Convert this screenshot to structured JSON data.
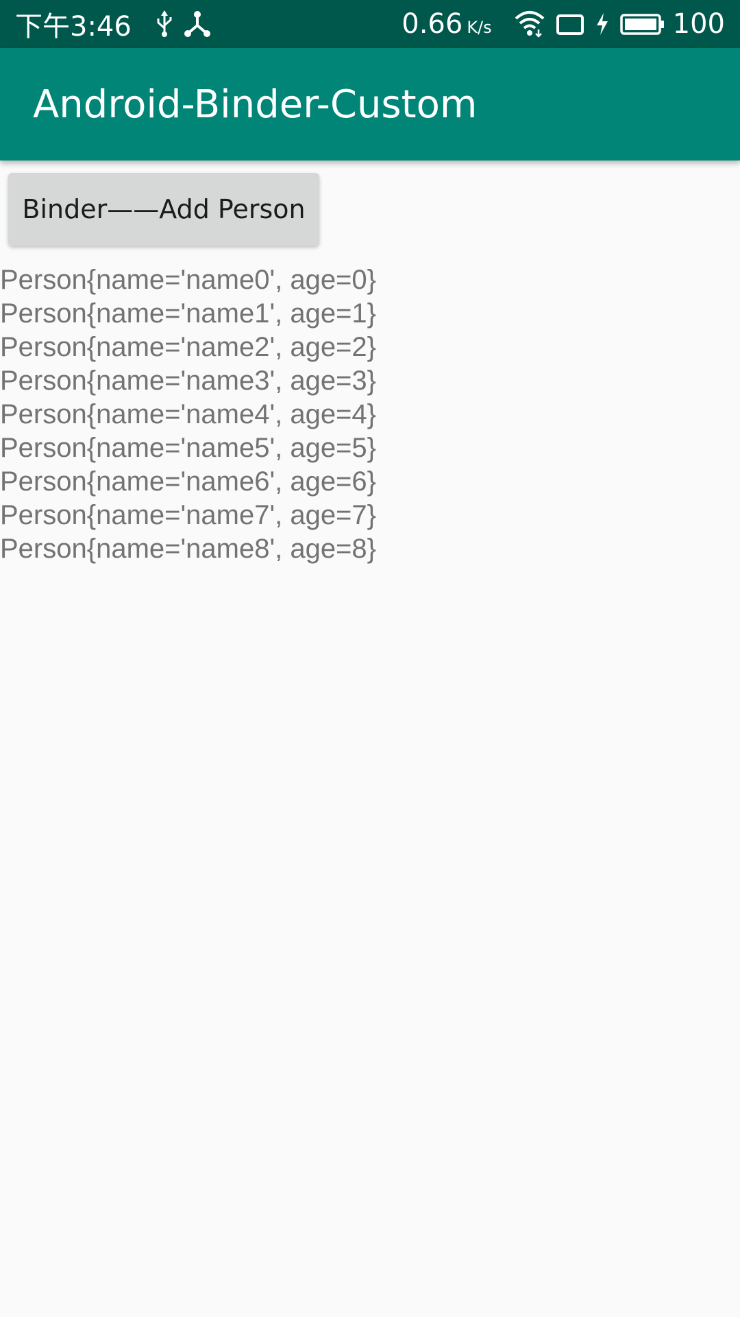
{
  "status_bar": {
    "time": "下午3:46",
    "network_speed": "0.66",
    "network_speed_unit": "K/s",
    "battery_level": "100",
    "icons": [
      "usb-icon",
      "usb-debug-icon",
      "wifi-icon",
      "screen-rotation-icon",
      "charging-bolt-icon",
      "battery-icon"
    ]
  },
  "app_bar": {
    "title": "Android-Binder-Custom"
  },
  "main": {
    "add_button_label": "Binder——Add Person",
    "persons": [
      "Person{name='name0', age=0}",
      "Person{name='name1', age=1}",
      "Person{name='name2', age=2}",
      "Person{name='name3', age=3}",
      "Person{name='name4', age=4}",
      "Person{name='name5', age=5}",
      "Person{name='name6', age=6}",
      "Person{name='name7', age=7}",
      "Person{name='name8', age=8}"
    ]
  },
  "colors": {
    "status_bar": "#00574b",
    "app_bar": "#008577",
    "background": "#fafafa",
    "button": "#d6d7d7",
    "list_text": "#737373"
  }
}
